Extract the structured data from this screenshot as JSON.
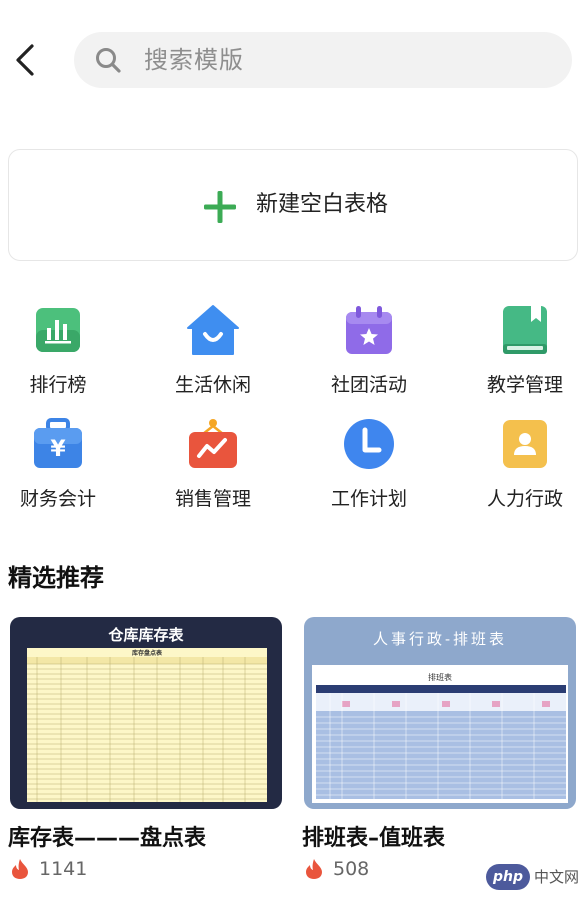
{
  "search": {
    "placeholder": "搜索模版"
  },
  "new_blank": {
    "label": "新建空白表格"
  },
  "categories": [
    {
      "label": "排行榜",
      "icon": "bar-chart-icon",
      "color": "#3db36b"
    },
    {
      "label": "生活休闲",
      "icon": "home-icon",
      "color": "#3f8ef0"
    },
    {
      "label": "社团活动",
      "icon": "calendar-star-icon",
      "color": "#8f6be8"
    },
    {
      "label": "教学管理",
      "icon": "book-icon",
      "color": "#3fae7a"
    },
    {
      "label": "财务会计",
      "icon": "yuan-briefcase-icon",
      "color": "#3d84e6"
    },
    {
      "label": "销售管理",
      "icon": "trend-board-icon",
      "color": "#e9553d"
    },
    {
      "label": "工作计划",
      "icon": "clock-icon",
      "color": "#3f86ee"
    },
    {
      "label": "人力行政",
      "icon": "person-card-icon",
      "color": "#f4c04d"
    }
  ],
  "section": {
    "title": "精选推荐"
  },
  "templates": [
    {
      "name": "库存表———盘点表",
      "count": "1141",
      "thumb_title": "仓库库存表",
      "thumb_subtitle": "库存盘点表"
    },
    {
      "name": "排班表–值班表",
      "count": "508",
      "thumb_title": "人事行政-排班表",
      "thumb_subtitle": "排班表"
    }
  ],
  "watermark": {
    "badge": "php",
    "text": "中文网"
  }
}
